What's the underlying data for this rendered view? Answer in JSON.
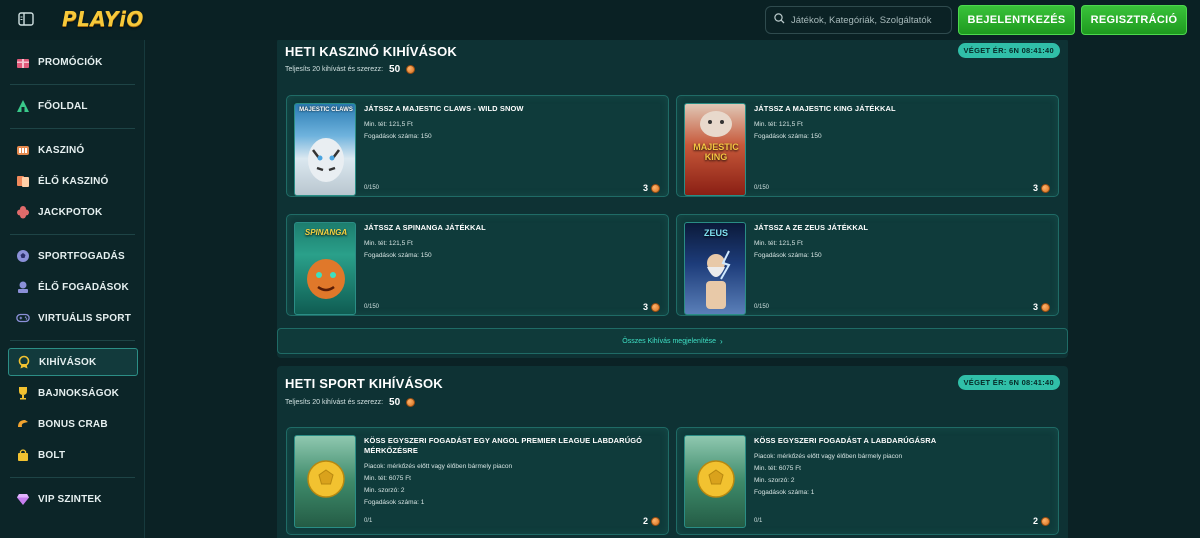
{
  "header": {
    "logo": "PLAYiO",
    "search_placeholder": "Játékok, Kategóriák, Szolgáltatók",
    "login_label": "BEJELENTKEZÉS",
    "register_label": "REGISZTRÁCIÓ"
  },
  "sidebar": {
    "items": [
      {
        "label": "PROMÓCIÓK",
        "icon": "gift-icon"
      },
      {
        "label": "FŐOLDAL",
        "icon": "home-icon"
      },
      {
        "label": "KASZINÓ",
        "icon": "casino-icon"
      },
      {
        "label": "ÉLŐ KASZINÓ",
        "icon": "cards-icon"
      },
      {
        "label": "JACKPOTOK",
        "icon": "clover-icon"
      },
      {
        "label": "SPORTFOGADÁS",
        "icon": "football-icon"
      },
      {
        "label": "ÉLŐ FOGADÁSOK",
        "icon": "live-icon"
      },
      {
        "label": "VIRTUÁLIS SPORT",
        "icon": "gamepad-icon"
      },
      {
        "label": "KIHÍVÁSOK",
        "icon": "medal-icon"
      },
      {
        "label": "BAJNOKSÁGOK",
        "icon": "trophy-icon"
      },
      {
        "label": "BONUS CRAB",
        "icon": "crab-claw-icon"
      },
      {
        "label": "BOLT",
        "icon": "shopping-bag-icon"
      },
      {
        "label": "VIP SZINTEK",
        "icon": "diamond-icon"
      }
    ]
  },
  "casino_section": {
    "title": "HETI KASZINÓ KIHÍVÁSOK",
    "subtitle": "Teljesíts 20 kihívást és szerezz:",
    "points": "50",
    "timer": "VÉGET ÉR: 6N 08:41:40",
    "show_all": "Összes Kihívás megjelenítése",
    "cards": [
      {
        "title": "JÁTSSZ A MAJESTIC CLAWS - WILD SNOW",
        "bet": "Min. tét: 121,5 Ft",
        "count": "Fogadások száma: 150",
        "progress": "0/150",
        "reward": "3",
        "thumb_text": "MAJESTIC CLAWS"
      },
      {
        "title": "JÁTSSZ A MAJESTIC KING JÁTÉKKAL",
        "bet": "Min. tét: 121,5 Ft",
        "count": "Fogadások száma: 150",
        "progress": "0/150",
        "reward": "3",
        "thumb_text": "MAJESTIC KING"
      },
      {
        "title": "JÁTSSZ A SPINANGA JÁTÉKKAL",
        "bet": "Min. tét: 121,5 Ft",
        "count": "Fogadások száma: 150",
        "progress": "0/150",
        "reward": "3",
        "thumb_text": "SPINANGA"
      },
      {
        "title": "JÁTSSZ A ZE ZEUS JÁTÉKKAL",
        "bet": "Min. tét: 121,5 Ft",
        "count": "Fogadások száma: 150",
        "progress": "0/150",
        "reward": "3",
        "thumb_text": "ZEUS"
      }
    ]
  },
  "sport_section": {
    "title": "HETI SPORT KIHÍVÁSOK",
    "subtitle": "Teljesíts 20 kihívást és szerezz:",
    "points": "50",
    "timer": "VÉGET ÉR: 6N 08:41:40",
    "cards": [
      {
        "title": "KÖSS EGYSZERI FOGADÁST EGY ANGOL PREMIER LEAGUE LABDARÚGÓ MÉRKŐZÉSRE",
        "line1": "Piacok: mérkőzés előtt vagy élőben bármely piacon",
        "line2": "Min. tét: 6075 Ft",
        "line3": "Min. szorzó: 2",
        "line4": "Fogadások száma: 1",
        "progress": "0/1",
        "reward": "2"
      },
      {
        "title": "KÖSS EGYSZERI FOGADÁST A LABDARÚGÁSRA",
        "line1": "Piacok: mérkőzés előtt vagy élőben bármely piacon",
        "line2": "Min. tét: 6075 Ft",
        "line3": "Min. szorzó: 2",
        "line4": "Fogadások száma: 1",
        "progress": "0/1",
        "reward": "2"
      }
    ]
  },
  "colors": {
    "accent_green": "#39c23a",
    "timer_teal": "#30bfa8",
    "logo_gold": "#f7c93a"
  }
}
